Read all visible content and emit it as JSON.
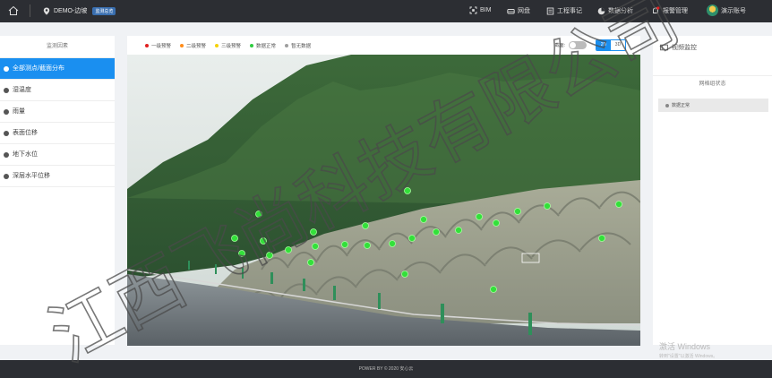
{
  "topbar": {
    "project": "DEMO-边坡",
    "project_badge": "监测总览",
    "nav": [
      {
        "icon": "bim-icon",
        "label": "BIM"
      },
      {
        "icon": "disk-icon",
        "label": "网盘"
      },
      {
        "icon": "notes-icon",
        "label": "工程事记"
      },
      {
        "icon": "analysis-icon",
        "label": "数据分析"
      },
      {
        "icon": "bell-icon",
        "label": "报警管理"
      }
    ],
    "user": "演示账号"
  },
  "left": {
    "title": "监测因素",
    "items": [
      {
        "label": "全部测点/截面分布",
        "active": true
      },
      {
        "label": "湿温度",
        "active": false
      },
      {
        "label": "雨量",
        "active": false
      },
      {
        "label": "表面位移",
        "active": false
      },
      {
        "label": "地下水位",
        "active": false
      },
      {
        "label": "深层水平位移",
        "active": false
      }
    ]
  },
  "center": {
    "legend": [
      {
        "label": "一级预警",
        "color": "#e02020"
      },
      {
        "label": "二级预警",
        "color": "#ff8c1a"
      },
      {
        "label": "三级预警",
        "color": "#f5d20a"
      },
      {
        "label": "数据正常",
        "color": "#2ecc40"
      },
      {
        "label": "暂无数据",
        "color": "#9e9e9e"
      }
    ],
    "section_label": "截面:",
    "view_2d": "2D",
    "view_3d": "3D"
  },
  "right": {
    "title": "视频监控",
    "subtitle": "网格组状态",
    "status_row": "数据正常"
  },
  "footer": "POWER BY © 2020 安心云",
  "windows_activation": {
    "line1": "激活 Windows",
    "line2": "转到\"设置\"以激活 Windows。"
  },
  "watermark": "江西飞尚科技有限公司",
  "colors": {
    "accent": "#1a8ff0",
    "topbar": "#2c2e33",
    "normal_point": "#2ecc40"
  }
}
